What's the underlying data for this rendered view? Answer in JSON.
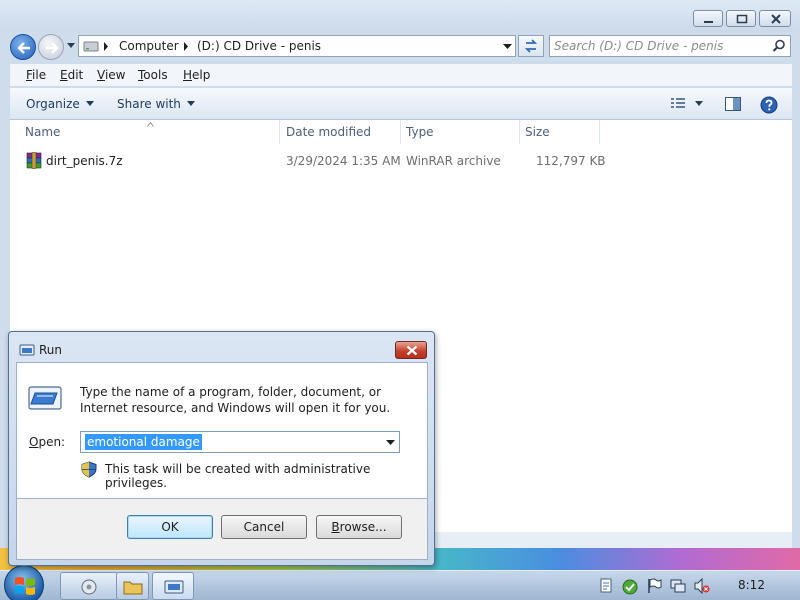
{
  "explorer": {
    "address": {
      "crumbs": [
        "Computer",
        "(D:) CD Drive - penis"
      ]
    },
    "search": {
      "placeholder": "Search (D:) CD Drive - penis"
    },
    "menu": [
      "File",
      "Edit",
      "View",
      "Tools",
      "Help"
    ],
    "toolbar": {
      "organize": "Organize",
      "share_with": "Share with"
    },
    "columns": [
      "Name",
      "Date modified",
      "Type",
      "Size"
    ],
    "files": [
      {
        "name": "dirt_penis.7z",
        "date_modified": "3/29/2024 1:35 AM",
        "type": "WinRAR archive",
        "size": "112,797 KB"
      }
    ]
  },
  "run_dialog": {
    "title": "Run",
    "description": "Type the name of a program, folder, document, or Internet resource, and Windows will open it for you.",
    "open_label": "Open:",
    "input_value": "emotional damage",
    "admin_note": "This task will be created with administrative privileges.",
    "ok": "OK",
    "cancel": "Cancel",
    "browse": "Browse..."
  },
  "taskbar": {
    "clock": "8:12"
  },
  "colors": {
    "accent": "#3399ff",
    "close_red": "#c4432f",
    "window_frame": "#cfdcec"
  }
}
